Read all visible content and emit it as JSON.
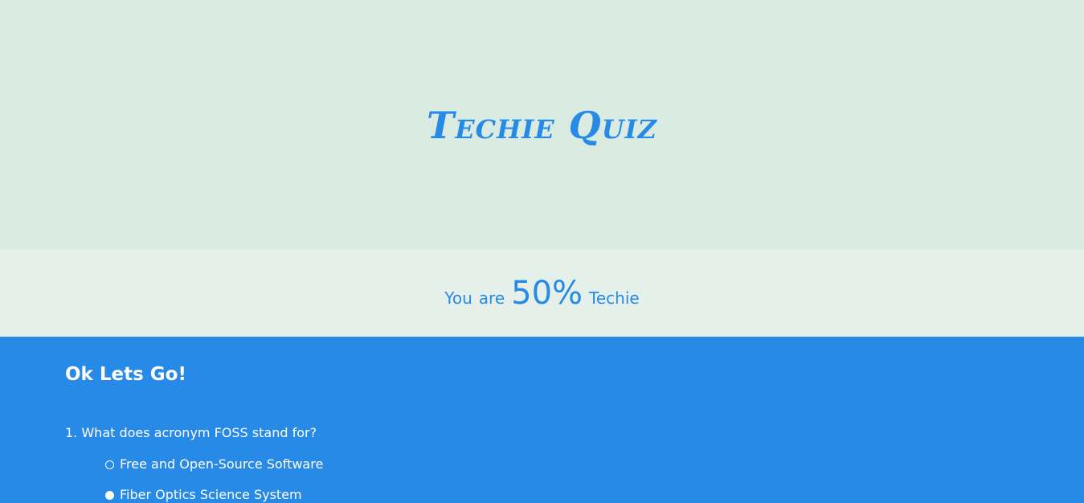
{
  "hero": {
    "title": "Techie Quiz"
  },
  "score": {
    "prefix_1": "You",
    "prefix_2": "are",
    "value": "50%",
    "suffix": "Techie"
  },
  "quiz": {
    "heading": "Ok Lets Go!",
    "questions": [
      {
        "text": "1. What does acronym FOSS stand for?",
        "options": [
          {
            "label": "Free and Open-Source Software",
            "selected": false
          },
          {
            "label": "Fiber Optics Science System",
            "selected": true
          }
        ]
      }
    ]
  },
  "colors": {
    "accent": "#288ae7",
    "hero_bg": "#daebe1",
    "score_bg": "#e6f0eb",
    "text_light": "#ffffff"
  }
}
